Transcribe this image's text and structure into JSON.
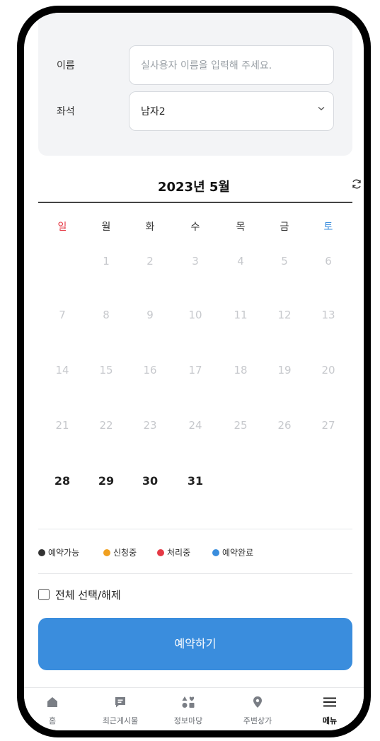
{
  "form": {
    "name_label": "이름",
    "name_placeholder": "실사용자 이름을 입력해 주세요.",
    "seat_label": "좌석",
    "seat_value": "남자2"
  },
  "calendar": {
    "title": "2023년 5월",
    "weekdays": [
      "일",
      "월",
      "화",
      "수",
      "목",
      "금",
      "토"
    ],
    "weeks": [
      [
        "",
        "1",
        "2",
        "3",
        "4",
        "5",
        "6"
      ],
      [
        "7",
        "8",
        "9",
        "10",
        "11",
        "12",
        "13"
      ],
      [
        "14",
        "15",
        "16",
        "17",
        "18",
        "19",
        "20"
      ],
      [
        "21",
        "22",
        "23",
        "24",
        "25",
        "26",
        "27"
      ],
      [
        "28",
        "29",
        "30",
        "31",
        "",
        "",
        ""
      ]
    ],
    "active_days": [
      "28",
      "29",
      "30",
      "31"
    ]
  },
  "legend": [
    {
      "label": "예약가능",
      "color": "#333333"
    },
    {
      "label": "신청중",
      "color": "#f0a020"
    },
    {
      "label": "처리중",
      "color": "#e53945"
    },
    {
      "label": "예약완료",
      "color": "#3a8ddd"
    }
  ],
  "select_all_label": "전체 선택/해제",
  "reserve_button": "예약하기",
  "nav": {
    "items": [
      {
        "label": "홈",
        "icon": "home-icon"
      },
      {
        "label": "최근게시물",
        "icon": "message-icon"
      },
      {
        "label": "정보마당",
        "icon": "grid-heart-icon"
      },
      {
        "label": "주변상가",
        "icon": "map-pin-icon"
      },
      {
        "label": "메뉴",
        "icon": "menu-icon"
      }
    ]
  },
  "colors": {
    "accent": "#3a8ddd",
    "sunday": "#e53945",
    "saturday": "#3a8ddd"
  }
}
